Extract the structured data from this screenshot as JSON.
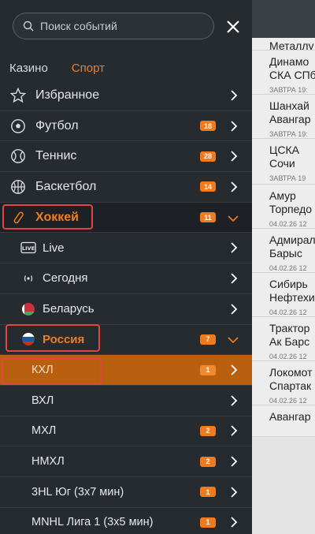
{
  "search": {
    "placeholder": "Поиск событий"
  },
  "tabs": [
    {
      "label": "Казино",
      "active": false
    },
    {
      "label": "Спорт",
      "active": true
    }
  ],
  "menu": {
    "favorites": {
      "label": "Избранное"
    },
    "football": {
      "label": "Футбол",
      "count": "18"
    },
    "tennis": {
      "label": "Теннис",
      "count": "28"
    },
    "basketball": {
      "label": "Баскетбол",
      "count": "14"
    },
    "hockey": {
      "label": "Хоккей",
      "count": "11"
    },
    "live": {
      "label": "Live"
    },
    "today": {
      "label": "Сегодня"
    },
    "belarus": {
      "label": "Беларусь"
    },
    "russia": {
      "label": "Россия",
      "count": "7"
    },
    "leagues": [
      {
        "label": "КХЛ",
        "count": "1"
      },
      {
        "label": "ВХЛ",
        "count": ""
      },
      {
        "label": "МХЛ",
        "count": "2"
      },
      {
        "label": "НМХЛ",
        "count": "2"
      },
      {
        "label": "3HL Юг (3x7 мин)",
        "count": "1"
      },
      {
        "label": "MNHL Лига 1 (3x5 мин)",
        "count": "1"
      }
    ]
  },
  "background_events": [
    {
      "teams": [
        "Металлу"
      ],
      "time": "ЗАВТРА 19:"
    },
    {
      "teams": [
        "Динамо",
        "СКА СПб"
      ],
      "time": "ЗАВТРА 19:"
    },
    {
      "teams": [
        "Шанхай",
        "Авангар"
      ],
      "time": "ЗАВТРА 19:"
    },
    {
      "teams": [
        "ЦСКА",
        "Сочи"
      ],
      "time": "ЗАВТРА 19"
    },
    {
      "teams": [
        "Амур",
        "Торпедо"
      ],
      "time": "04.02.26 12"
    },
    {
      "teams": [
        "Адмирал",
        "Барыс"
      ],
      "time": "04.02.26 12"
    },
    {
      "teams": [
        "Сибирь",
        "Нефтехи"
      ],
      "time": "04.02.26 12"
    },
    {
      "teams": [
        "Трактор",
        "Ак Барс"
      ],
      "time": "04.02.26 12"
    },
    {
      "teams": [
        "Локомот",
        "Спартак"
      ],
      "time": "04.02.26 12"
    },
    {
      "teams": [
        "Авангар"
      ],
      "time": ""
    }
  ],
  "colors": {
    "accent": "#f27d20",
    "highlight": "#e3463f",
    "selected_row": "#b85f10"
  }
}
